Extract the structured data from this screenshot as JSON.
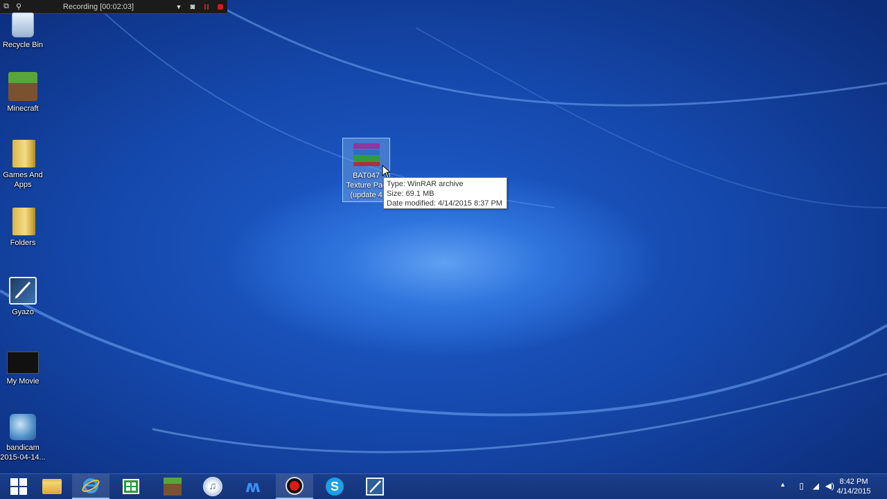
{
  "recording_bar": {
    "title": "Recording [00:02:03]"
  },
  "desktop_icons": [
    {
      "label": "Recycle Bin",
      "icon": "recycle-bin-icon"
    },
    {
      "label": "Minecraft",
      "icon": "minecraft-icon"
    },
    {
      "label": "Games And Apps",
      "icon": "folder-icon"
    },
    {
      "label": "Folders",
      "icon": "folder-icon"
    },
    {
      "label": "Gyazo",
      "icon": "gyazo-icon"
    },
    {
      "label": "My Movie",
      "icon": "movie-file-icon"
    },
    {
      "label": "bandicam 2015-04-14...",
      "icon": "bandicam-video-icon"
    }
  ],
  "selected_file": {
    "line1": "BAT047",
    "line2": "Texture Pac",
    "line3": "(update 4",
    "icon": "winrar-archive-icon"
  },
  "tooltip": {
    "type": "Type: WinRAR archive",
    "size": "Size: 69.1 MB",
    "modified": "Date modified: 4/14/2015 8:37 PM"
  },
  "taskbar": {
    "items": [
      "start-icon",
      "file-explorer-icon",
      "internet-explorer-icon",
      "store-icon",
      "minecraft-icon",
      "itunes-icon",
      "malwarebytes-icon",
      "bandicam-icon",
      "skype-icon",
      "gyazo-icon"
    ],
    "clock_time": "8:42 PM",
    "clock_date": "4/14/2015"
  },
  "colors": {
    "desktop_blue": "#1446a8",
    "taskbar": "#14337a",
    "record_red": "#d01a1a"
  }
}
